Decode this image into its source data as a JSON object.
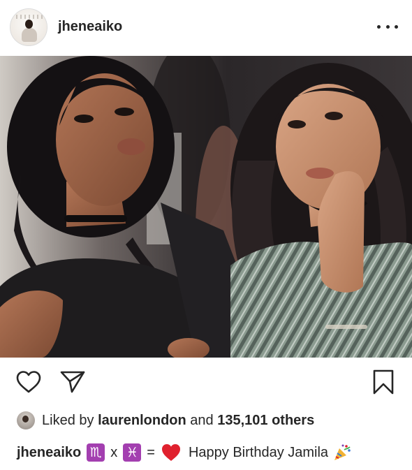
{
  "post": {
    "username": "jheneaiko",
    "avatar_icon": "profile-avatar-icon",
    "more_icon": "more-options-icon"
  },
  "actions": {
    "like_icon": "heart-outline-icon",
    "share_icon": "paper-plane-icon",
    "save_icon": "bookmark-icon"
  },
  "likes": {
    "prefix": "Liked by",
    "user": "laurenlondon",
    "connector": "and",
    "count": "135,101 others"
  },
  "caption": {
    "username": "jheneaiko",
    "sign_one": "♏",
    "op_times": "x",
    "sign_two": "♓",
    "op_equals": "=",
    "text": "Happy Birthday Jamila",
    "heart_icon": "red-heart-emoji",
    "party_icon": "party-popper-emoji"
  },
  "colors": {
    "text": "#262626",
    "zodiac_purple": "#a33fb0",
    "heart_red": "#e0212e"
  }
}
